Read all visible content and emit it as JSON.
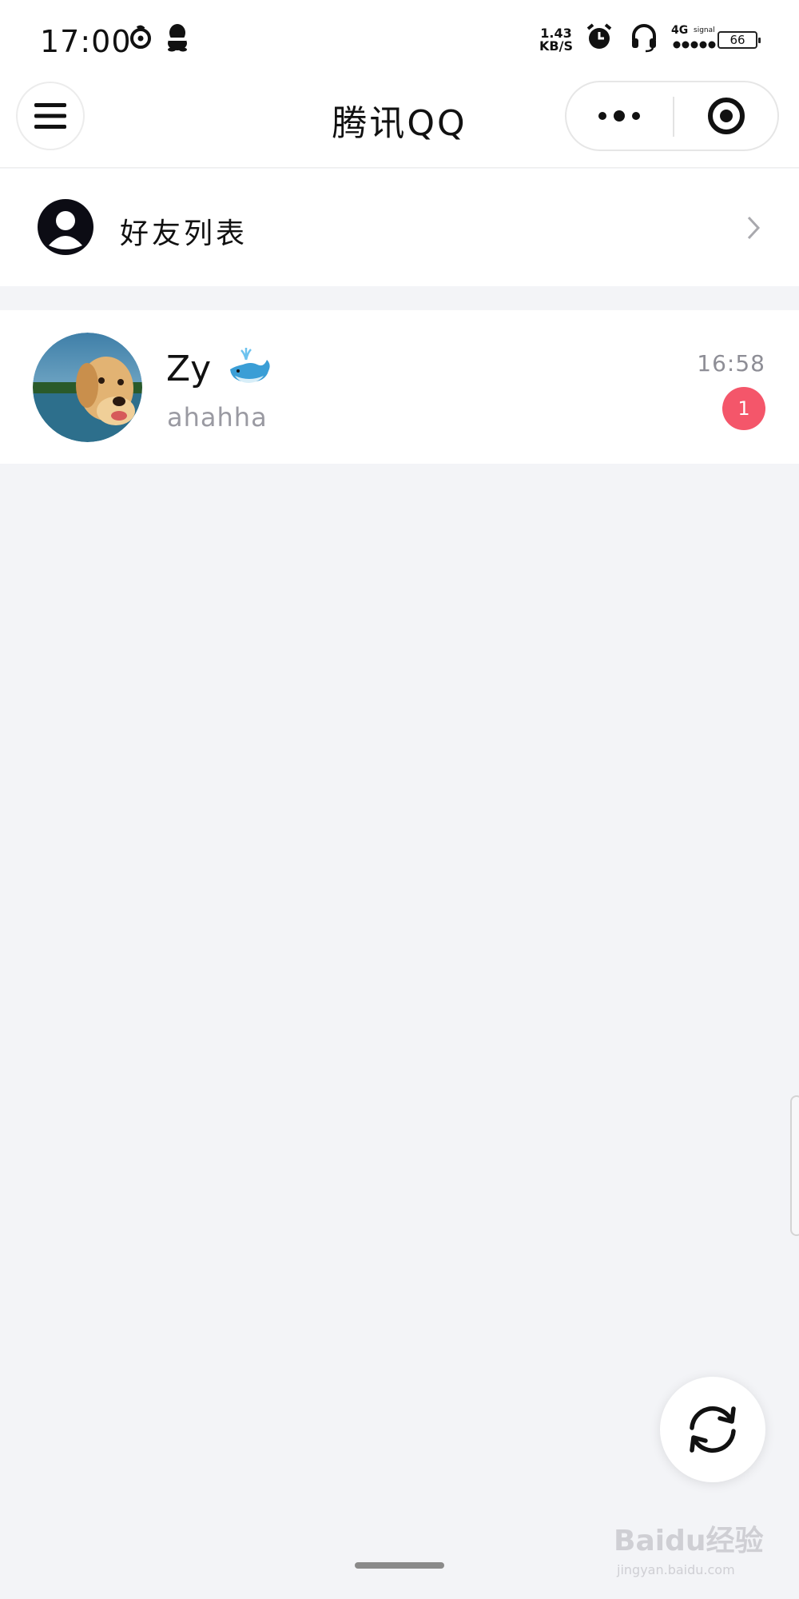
{
  "status_bar": {
    "time": "17:00",
    "speed_value": "1.43",
    "speed_unit": "KB/S",
    "network": "4G",
    "signal_label": "signal",
    "battery": "66",
    "icons": [
      "netease-music-icon",
      "qq-penguin-icon",
      "alarm-icon",
      "headset-icon",
      "signal-icon",
      "battery-icon"
    ]
  },
  "nav": {
    "title": "腾讯QQ",
    "icons": [
      "menu-icon",
      "more-icon",
      "close-target-icon"
    ]
  },
  "friends_entry": {
    "label": "好友列表",
    "icon": "user-avatar-icon"
  },
  "chats": [
    {
      "name": "Zy",
      "emoji": "whale-emoji",
      "last_message": "ahahha",
      "time": "16:58",
      "unread": "1"
    }
  ],
  "floating": {
    "icon": "refresh-icon"
  },
  "watermark": {
    "text": "Baidu经验",
    "sub": "jingyan.baidu.com"
  },
  "colors": {
    "background": "#f3f4f7",
    "badge": "#f4566a",
    "secondary_text": "#9a9aa2"
  }
}
